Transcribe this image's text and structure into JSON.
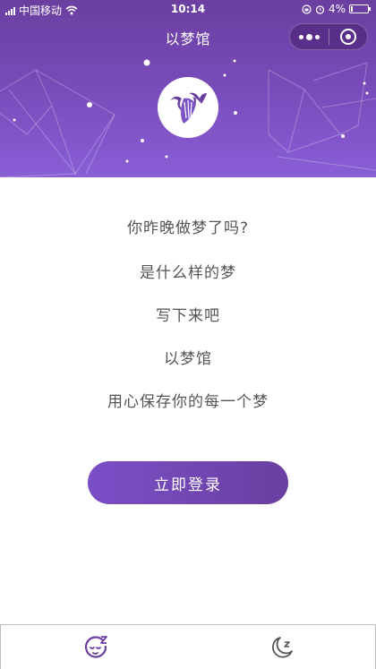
{
  "status_bar": {
    "carrier": "中国移动",
    "time": "10:14",
    "battery": "4%"
  },
  "nav": {
    "title": "以梦馆"
  },
  "content": {
    "lines": [
      "你昨晚做梦了吗?",
      "是什么样的梦",
      "写下来吧",
      "以梦馆",
      "用心保存你的每一个梦"
    ]
  },
  "login_button": {
    "label": "立即登录"
  },
  "tabbar": {
    "tabs": [
      {
        "icon": "sleepy-face-icon"
      },
      {
        "icon": "moon-z-icon"
      }
    ]
  },
  "colors": {
    "primary": "#6b3fa0",
    "accent": "#8a5fd6",
    "text": "#555555"
  }
}
